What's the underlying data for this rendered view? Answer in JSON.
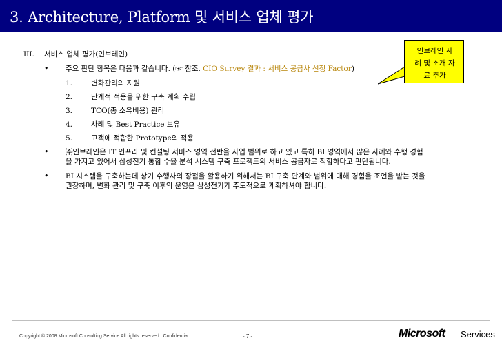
{
  "slide": {
    "title": "3.  Architecture, Platform 및 서비스 업체 평가",
    "section_numeral": "III.",
    "section_heading": "서비스 업체 평가(인브레인)",
    "bullet1": {
      "text_before": "주요 판단 항목은 다음과 같습니다. (",
      "icon_glyph": "☞",
      "text_ref": " 참조. ",
      "link": "CIO Survey 결과 : 서비스 공급사 선정 Factor",
      "text_after": ")"
    },
    "items": [
      {
        "num": "1.",
        "text": "변화관리의 지원"
      },
      {
        "num": "2.",
        "text": "단계적 적용을 위한 구축 계획 수립"
      },
      {
        "num": "3.",
        "text": "TCO(총 소유비용) 관리"
      },
      {
        "num": "4.",
        "text": "사례 및 Best Practice 보유"
      },
      {
        "num": "5.",
        "text": "고객에 적합한 Prototype의 적용"
      }
    ],
    "bullet2": {
      "line1": "㈜인브레인은 IT 인프라 및 컨설팅 서비스 영역 전반을 사업 범위로 하고 있고 특히 BI 영역에서 많은 사례와 수행 경험",
      "line2": "을 가지고 있어서 삼성전기 통합 수율 분석 시스템 구축 프로젝트의 서비스 공급자로 적합하다고 판단됩니다."
    },
    "bullet3": {
      "line1": "BI 시스템을 구축하는데 상기 수행사의 장점을 활용하기 위해서는 BI 구축 단계와 범위에 대해 경험을 조언을 받는 것을",
      "line2": "권장하며, 변화 관리 및 구축 이후의 운영은 삼성전기가 주도적으로 계획하셔야 합니다."
    },
    "bullet_glyph": "•",
    "callout": "인브레인 사\n례 및 소개 자\n료 추가"
  },
  "footer": {
    "copyright": "Copyright © 2008 Microsoft Consulting Service All rights reserved  |  Confidential",
    "page": "- 7 -",
    "logo": "Microsoft",
    "services": "Services"
  },
  "colors": {
    "title_bar": "#000080",
    "callout": "#ffff00",
    "link": "#b8860b"
  }
}
